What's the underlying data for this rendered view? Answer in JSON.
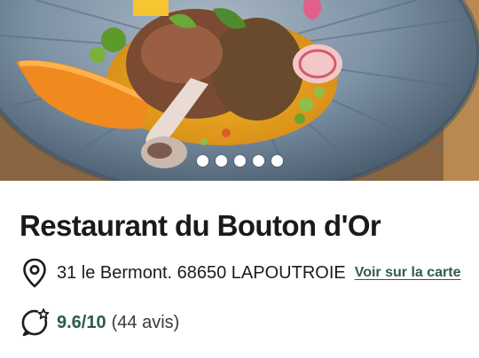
{
  "gallery": {
    "image_alt": "",
    "slide_count": 5,
    "active_slide": 1
  },
  "restaurant": {
    "name": "Restaurant du Bouton d'Or",
    "address": "31 le Bermont. 68650 LAPOUTROIE",
    "map_link": "Voir sur la carte",
    "rating": "9.6/10",
    "reviews": "(44 avis)"
  },
  "icons": {
    "address": "location-pin-icon",
    "rating": "rating-badge-icon"
  },
  "colors": {
    "accent": "#2f5b50",
    "title": "#1a1a1a"
  }
}
